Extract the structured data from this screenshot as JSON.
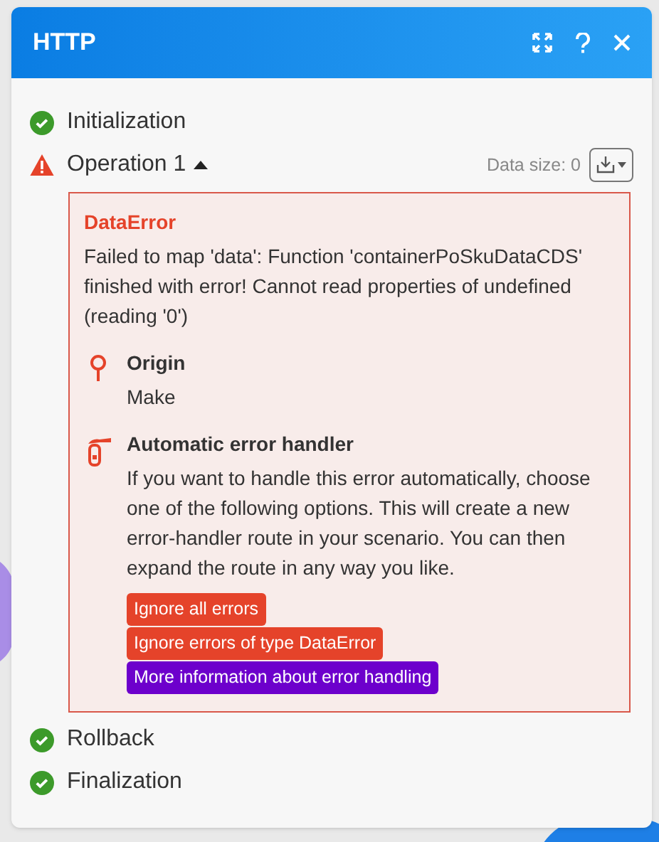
{
  "window": {
    "title": "HTTP"
  },
  "steps": [
    {
      "label": "Initialization",
      "kind": "success"
    },
    {
      "label": "Operation 1",
      "kind": "error",
      "expanded": true,
      "data_size": "Data size: 0",
      "error": {
        "title": "DataError",
        "message": "Failed to map 'data': Function 'containerPoSkuDataCDS' finished with error! Cannot read properties of undefined (reading '0')",
        "sections": [
          {
            "kind": "origin",
            "title": "Origin",
            "text": "Make"
          },
          {
            "kind": "handler",
            "title": "Automatic error handler",
            "text": "If you want to handle this error automatically, choose one of the following options. This will create a new error-handler route in your scenario. You can then expand the route in any way you like.",
            "actions": [
              {
                "label": "Ignore all errors",
                "kind": "danger"
              },
              {
                "label": "Ignore errors of type DataError",
                "kind": "danger"
              },
              {
                "label": "More information about error handling",
                "kind": "info"
              }
            ]
          }
        ]
      }
    },
    {
      "label": "Rollback",
      "kind": "success"
    },
    {
      "label": "Finalization",
      "kind": "success"
    }
  ]
}
